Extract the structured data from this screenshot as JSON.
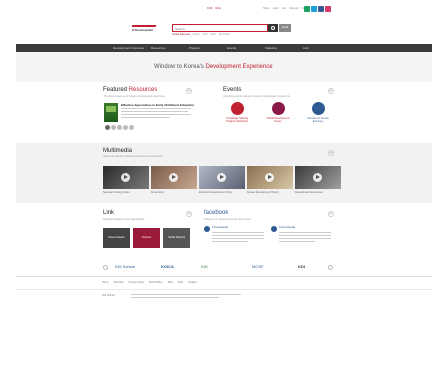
{
  "header": {
    "language_links": [
      "KOR",
      "ENG"
    ],
    "utility_links": [
      "Home",
      "Login",
      "Join",
      "Sitemap",
      "Contact"
    ],
    "social": [
      {
        "icon": "blog-icon",
        "color": "#1aa261"
      },
      {
        "icon": "twitter-icon",
        "color": "#1f9fd8"
      },
      {
        "icon": "facebook-icon",
        "color": "#3b5998"
      },
      {
        "icon": "flickr-icon",
        "color": "#d33a6a"
      }
    ],
    "logo_text": "K-Developedia",
    "search_placeholder": "Search",
    "detail_search": "Detail",
    "popular_keywords": [
      "Global Saemaul",
      "Korea",
      "KSP",
      "ODA",
      "Education"
    ]
  },
  "nav": {
    "items": [
      "Development Overview",
      "Resources",
      "Projects",
      "Events",
      "Statistics",
      "Link"
    ]
  },
  "hero": {
    "prefix": "Window to Korea's",
    "highlight": "Development Experience"
  },
  "featured": {
    "title_a": "Featured",
    "title_b": "Resources",
    "subtitle": "The best resources of Korea's development experience",
    "item_title": "Effective Approaches to Early Childhood Education",
    "slides": 5,
    "active_slide": 1
  },
  "events": {
    "title": "Events",
    "subtitle": "Upcoming events related to Korea's development experience",
    "items": [
      {
        "caption": "Knowledge Sharing Program Workshop",
        "color": "#c0212f"
      },
      {
        "caption": "Global Development Forum",
        "color": "#8a1a4a"
      },
      {
        "caption": "Seminar on Korean Economy",
        "color": "#2d5b92"
      }
    ]
  },
  "multimedia": {
    "title": "Multimedia",
    "subtitle": "Videos and photos of Korea's development experience",
    "items": [
      {
        "caption": "Saemaul Undong Video",
        "c1": "#2a2a2a",
        "c2": "#7a7a7a"
      },
      {
        "caption": "Korea Story",
        "c1": "#7a5a4a",
        "c2": "#c8a890"
      },
      {
        "caption": "Economic Development Story",
        "c1": "#b0b8c8",
        "c2": "#5a6070"
      },
      {
        "caption": "Korean Development History",
        "c1": "#8a7050",
        "c2": "#d8c8a8"
      },
      {
        "caption": "Development Experience",
        "c1": "#3a3a3a",
        "c2": "#a0a0a0"
      }
    ]
  },
  "link": {
    "title": "Link",
    "subtitle": "Related institutions and organizations",
    "boxes": [
      {
        "label": "Korea Network",
        "color": "#444444"
      },
      {
        "label": "Partners",
        "color": "#9a1a3a"
      },
      {
        "label": "Global Network",
        "color": "#555555"
      }
    ]
  },
  "facebook": {
    "title": "facebook",
    "subtitle": "Follow us on Facebook for the latest news",
    "posts": [
      {
        "name": "K-Developedia"
      },
      {
        "name": "K-Developedia"
      }
    ]
  },
  "partners": [
    "KDI School",
    "KOICA",
    "KDI",
    "MOSF",
    "KDI"
  ],
  "footer": {
    "links": [
      "Home",
      "Site Map",
      "Privacy Policy",
      "Email Policy",
      "RSS",
      "FAQ",
      "Contact"
    ],
    "logo": "KDI School"
  }
}
